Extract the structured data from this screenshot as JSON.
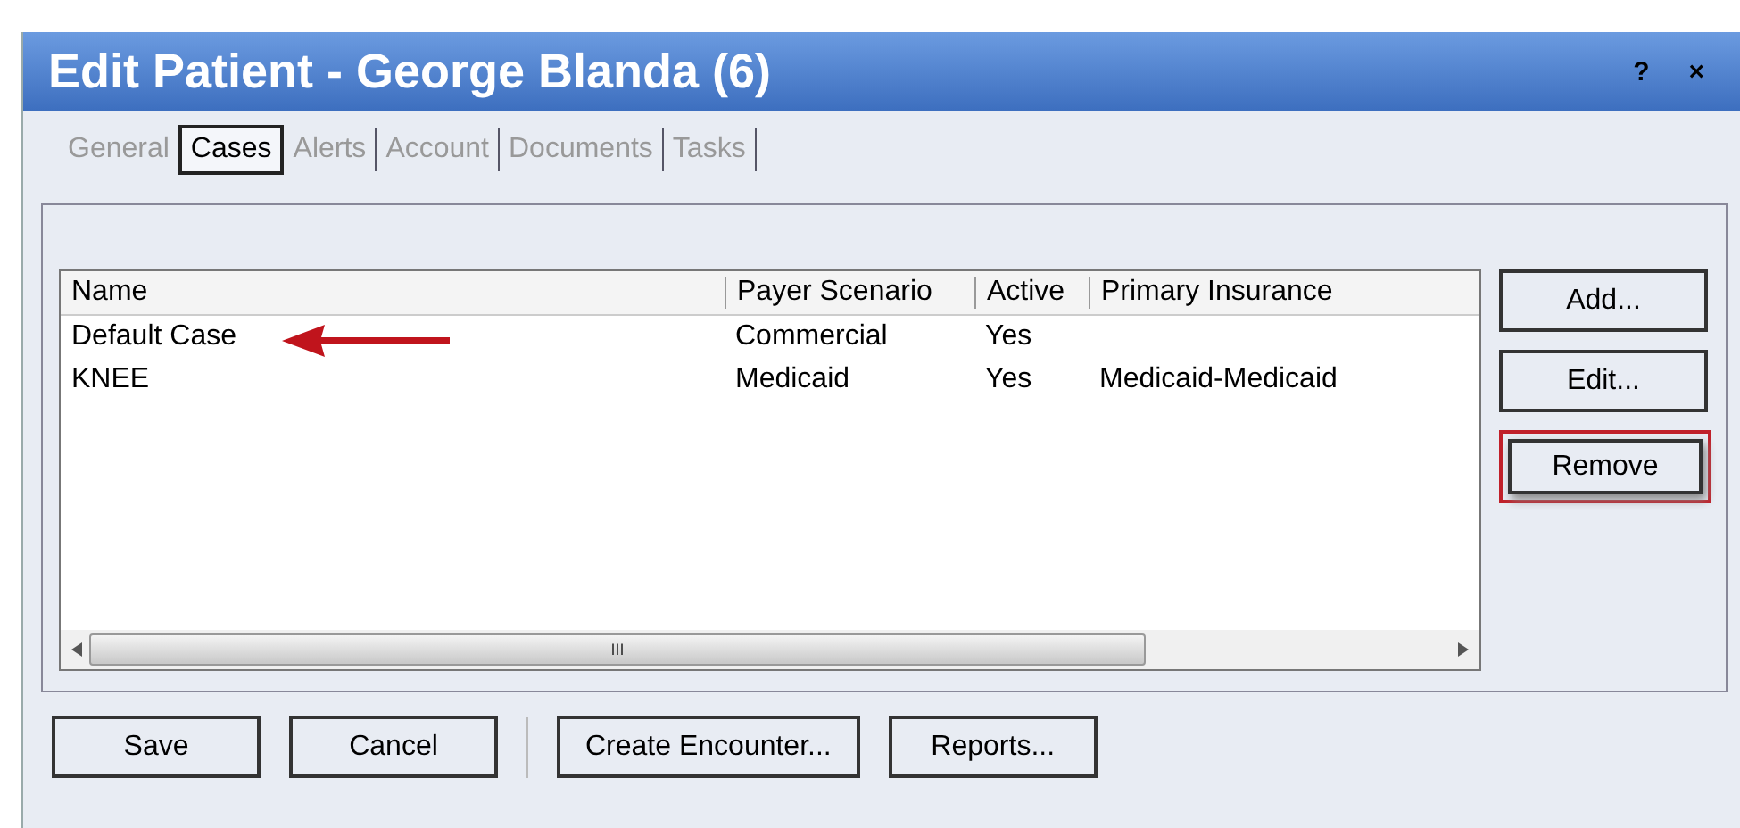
{
  "window": {
    "title": "Edit Patient - George Blanda (6)",
    "help": "?",
    "close": "×"
  },
  "tabs": [
    {
      "label": "General",
      "selected": false
    },
    {
      "label": "Cases",
      "selected": true
    },
    {
      "label": "Alerts",
      "selected": false
    },
    {
      "label": "Account",
      "selected": false
    },
    {
      "label": "Documents",
      "selected": false
    },
    {
      "label": "Tasks",
      "selected": false
    }
  ],
  "cases_table": {
    "columns": [
      "Name",
      "Payer Scenario",
      "Active",
      "Primary Insurance"
    ],
    "rows": [
      {
        "cells": [
          "Default Case",
          "Commercial",
          "Yes",
          ""
        ],
        "pointed": true
      },
      {
        "cells": [
          "KNEE",
          "Medicaid",
          "Yes",
          "Medicaid-Medicaid"
        ],
        "pointed": false
      }
    ],
    "scroll_grip": "III"
  },
  "side_buttons": [
    {
      "label": "Add...",
      "highlighted": false
    },
    {
      "label": "Edit...",
      "highlighted": false
    },
    {
      "label": "Remove",
      "highlighted": true
    }
  ],
  "footer_buttons": [
    {
      "label": "Save",
      "separator_after": false
    },
    {
      "label": "Cancel",
      "separator_after": true
    },
    {
      "label": "Create Encounter...",
      "separator_after": false
    },
    {
      "label": "Reports...",
      "separator_after": false
    }
  ]
}
